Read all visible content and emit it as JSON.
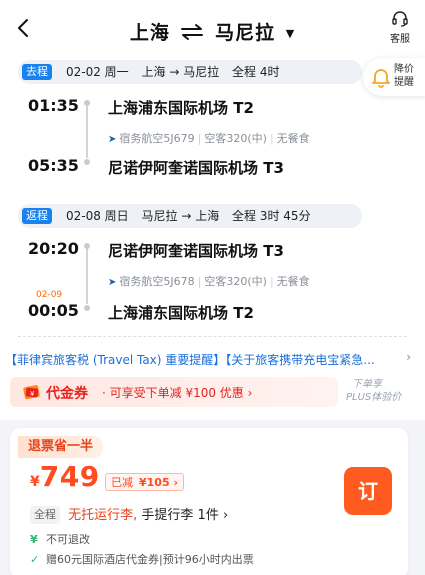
{
  "header": {
    "origin": "上海",
    "destination": "马尼拉",
    "service_label": "客服"
  },
  "outbound": {
    "tag": "去程",
    "date": "02-02 周一",
    "route": "上海 → 马尼拉",
    "duration": "全程 4时",
    "depart_time": "01:35",
    "depart_airport": "上海浦东国际机场 T2",
    "flight": "宿务航空5J679",
    "aircraft": "空客320(中)",
    "meal": "无餐食",
    "arrive_time": "05:35",
    "arrive_airport": "尼诺伊阿奎诺国际机场 T3"
  },
  "price_alert": {
    "label": "降价提醒"
  },
  "return": {
    "tag": "返程",
    "date": "02-08 周日",
    "route": "马尼拉 → 上海",
    "duration": "全程 3时 45分",
    "depart_time": "20:20",
    "depart_airport": "尼诺伊阿奎诺国际机场 T3",
    "flight": "宿务航空5J678",
    "aircraft": "空客320(中)",
    "meal": "无餐食",
    "arrive_date": "02-09",
    "arrive_time": "00:05",
    "arrive_airport": "上海浦东国际机场 T2"
  },
  "notice": {
    "text": "【菲律宾旅客税 (Travel Tax) 重要提醒】【关于旅客携带充电宝紧急...",
    "arrow": "›"
  },
  "coupon": {
    "title": "代金券",
    "desc": "· 可享受下单减 ¥100 优惠 ›"
  },
  "plus_tip": {
    "line1": "下单享",
    "line2": "PLUS体验价"
  },
  "fare": {
    "badge": "退票省一半",
    "currency": "¥",
    "price": "749",
    "discount_label": "已减",
    "discount_amount": "¥105 ›",
    "book_label": "订",
    "baggage_scope": "全程",
    "baggage_checked": "无托运行李,",
    "baggage_carry": "手提行李 1件 ›",
    "rule1": "不可退改",
    "rule2": "赠60元国际酒店代金券|预计96小时内出票"
  },
  "colors": {
    "accent_blue": "#1a82f0",
    "price_orange": "#ff4b1f",
    "book_button": "#ff5a1f",
    "coupon_red": "#e8221f"
  }
}
